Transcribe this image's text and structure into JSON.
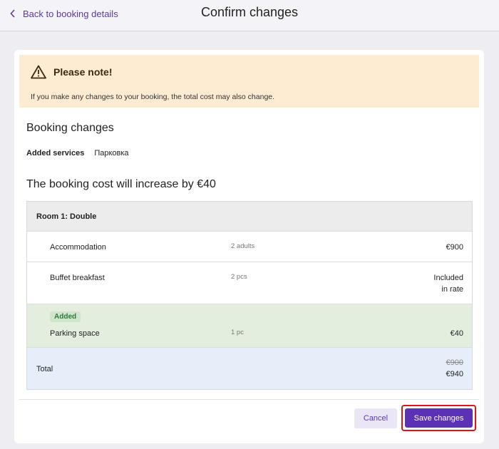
{
  "header": {
    "back_label": "Back to booking details",
    "title": "Confirm changes"
  },
  "notice": {
    "title": "Please note!",
    "text": "If you make any changes to your booking, the total cost may also change."
  },
  "booking_changes": {
    "title": "Booking changes",
    "services_label": "Added services",
    "services_value": "Парковка"
  },
  "cost": {
    "title": "The booking cost will increase by €40"
  },
  "table": {
    "room_title": "Room 1: Double",
    "rows": [
      {
        "name": "Accommodation",
        "qty": "2 adults",
        "price": "€900"
      },
      {
        "name": "Buffet breakfast",
        "qty": "2 pcs",
        "price_line1": "Included",
        "price_line2": "in rate"
      },
      {
        "badge": "Added",
        "name": "Parking space",
        "qty": "1 pc",
        "price": "€40"
      }
    ],
    "total": {
      "label": "Total",
      "old": "€900",
      "new": "€940"
    }
  },
  "actions": {
    "cancel_label": "Cancel",
    "save_label": "Save changes"
  },
  "colors": {
    "accent": "#5b32b3",
    "notice_bg": "#fdecd2",
    "added_bg": "#e4eedf",
    "total_bg": "#e6eef9",
    "highlight": "#e0121c"
  }
}
